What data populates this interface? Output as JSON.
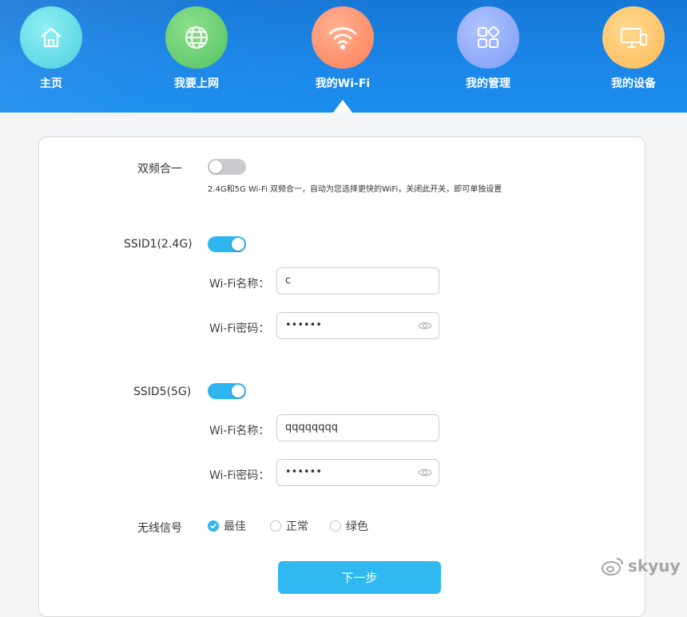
{
  "nav": {
    "items": [
      {
        "label": "主页",
        "icon": "home-icon",
        "color": "#5ed7e6"
      },
      {
        "label": "我要上网",
        "icon": "globe-icon",
        "color": "#5fcc6a"
      },
      {
        "label": "我的Wi-Fi",
        "icon": "wifi-icon",
        "color": "#ff8a5c",
        "active": true
      },
      {
        "label": "我的管理",
        "icon": "apps-icon",
        "color": "#7ea0ff"
      },
      {
        "label": "我的设备",
        "icon": "devices-icon",
        "color": "#ffc45c"
      }
    ]
  },
  "dual_band": {
    "label": "双频合一",
    "enabled": false,
    "hint": "2.4G和5G Wi-Fi 双频合一，自动为您选择更快的WiFi，关闭此开关，即可单独设置"
  },
  "ssid24": {
    "label": "SSID1(2.4G)",
    "enabled": true,
    "name_label": "Wi-Fi名称：",
    "name_value": "c",
    "password_label": "Wi-Fi密码：",
    "password_value": "••••••"
  },
  "ssid5": {
    "label": "SSID5(5G)",
    "enabled": true,
    "name_label": "Wi-Fi名称：",
    "name_value": "qqqqqqqq",
    "password_label": "Wi-Fi密码：",
    "password_value": "••••••"
  },
  "signal": {
    "label": "无线信号",
    "options": [
      {
        "label": "最佳",
        "checked": true
      },
      {
        "label": "正常",
        "checked": false
      },
      {
        "label": "绿色",
        "checked": false
      }
    ]
  },
  "next_button": "下一步",
  "watermark": "skyuy",
  "colors": {
    "header": "#1a86e8",
    "accent": "#2fb6ee",
    "toggle_off": "#c9cbcf"
  }
}
